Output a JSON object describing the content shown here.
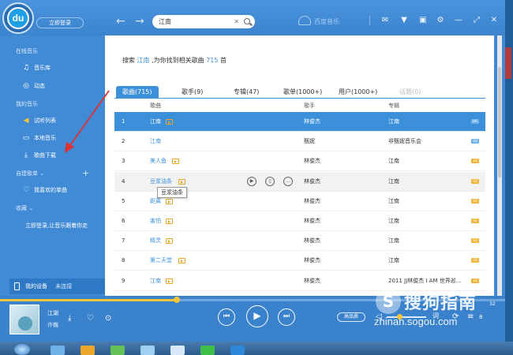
{
  "topbar": {
    "logo_text": "du",
    "login_label": "立即登录",
    "search_value": "江南",
    "search_clear": "✕",
    "brand": "百度音乐"
  },
  "sidebar": {
    "online_head": "在线音乐",
    "online_items": [
      {
        "label": "音乐库",
        "icon": "music-note-icon"
      },
      {
        "label": "动态",
        "icon": "dynamic-icon"
      }
    ],
    "mymusic_head": "我的音乐",
    "mymusic_items": [
      {
        "label": "试听列表",
        "icon": "speaker-icon"
      },
      {
        "label": "本地音乐",
        "icon": "monitor-icon"
      },
      {
        "label": "歌曲下载",
        "icon": "download-icon"
      }
    ],
    "playlist_head": "自建歌单",
    "favorite_label": "我喜欢的单曲",
    "collect_head": "收藏",
    "collect_hint": "立即登录,让音乐跟着你走",
    "device_label": "我的设备",
    "device_status": "未连接"
  },
  "content": {
    "summary_pre": "搜索",
    "summary_kw": "江南",
    "summary_mid": ",为你找到相关歌曲",
    "summary_num": "715",
    "summary_post": "首",
    "tabs": [
      {
        "label": "歌曲(715)"
      },
      {
        "label": "歌手(9)"
      },
      {
        "label": "专辑(47)"
      },
      {
        "label": "歌单(1000+)"
      },
      {
        "label": "用户(1000+)"
      },
      {
        "label": "话题(0)"
      }
    ],
    "columns": {
      "song": "歌曲",
      "artist": "歌手",
      "album": "专辑"
    },
    "rows": [
      {
        "idx": "1",
        "song": "江南",
        "artist": "林俊杰",
        "album": "江南",
        "quality": "HR"
      },
      {
        "idx": "2",
        "song": "江南",
        "artist": "甄妮",
        "album": "非甄妮音乐会",
        "quality": "HQ"
      },
      {
        "idx": "3",
        "song": "美人鱼",
        "artist": "林俊杰",
        "album": "江南",
        "quality": "SQ"
      },
      {
        "idx": "4",
        "song": "豆浆油条",
        "artist": "林俊杰",
        "album": "江南",
        "quality": "SQ"
      },
      {
        "idx": "5",
        "song": "距离",
        "artist": "林俊杰",
        "album": "江南",
        "quality": "SQ"
      },
      {
        "idx": "6",
        "song": "害怕",
        "artist": "林俊杰",
        "album": "江南",
        "quality": "SQ"
      },
      {
        "idx": "7",
        "song": "精灵",
        "artist": "林俊杰",
        "album": "江南",
        "quality": "SQ"
      },
      {
        "idx": "8",
        "song": "第二天堂",
        "artist": "林俊杰",
        "album": "江南",
        "quality": "SQ"
      },
      {
        "idx": "9",
        "song": "江南",
        "artist": "林俊杰",
        "album": "2011 JJ林俊杰 I AM 世界巡...",
        "quality": "SQ"
      }
    ],
    "tooltip": "豆浆油条"
  },
  "player": {
    "title": "江湖",
    "artist": "许巍",
    "quality_label": "高品质",
    "time": "32",
    "lyric_label": "词",
    "count": "8",
    "progress": 0.35
  },
  "watermark": {
    "text": "搜狗指南",
    "url": "zhinan.sogou.com"
  },
  "colors": {
    "accent": "#3c8fd9",
    "sidebar": "#418ad5",
    "highlight": "#f3c53a",
    "annotation": "#e03030"
  }
}
